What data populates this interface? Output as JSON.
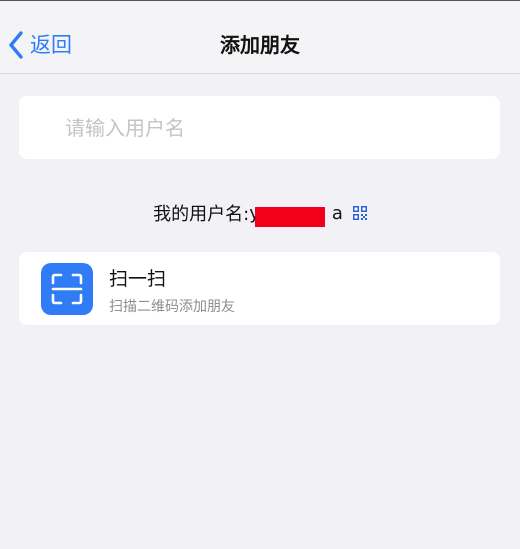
{
  "nav": {
    "back_label": "返回",
    "title": "添加朋友"
  },
  "search": {
    "placeholder": "请输入用户名",
    "value": ""
  },
  "my_username": {
    "label": "我的用户名:",
    "visible_prefix": "y",
    "visible_suffix": "a",
    "qr_icon": "qr-code-icon"
  },
  "scan": {
    "icon": "scan-icon",
    "title": "扫一扫",
    "subtitle": "扫描二维码添加朋友"
  },
  "colors": {
    "accent": "#2f7cf6",
    "background": "#f2f2f6",
    "redaction": "#f2001b"
  }
}
